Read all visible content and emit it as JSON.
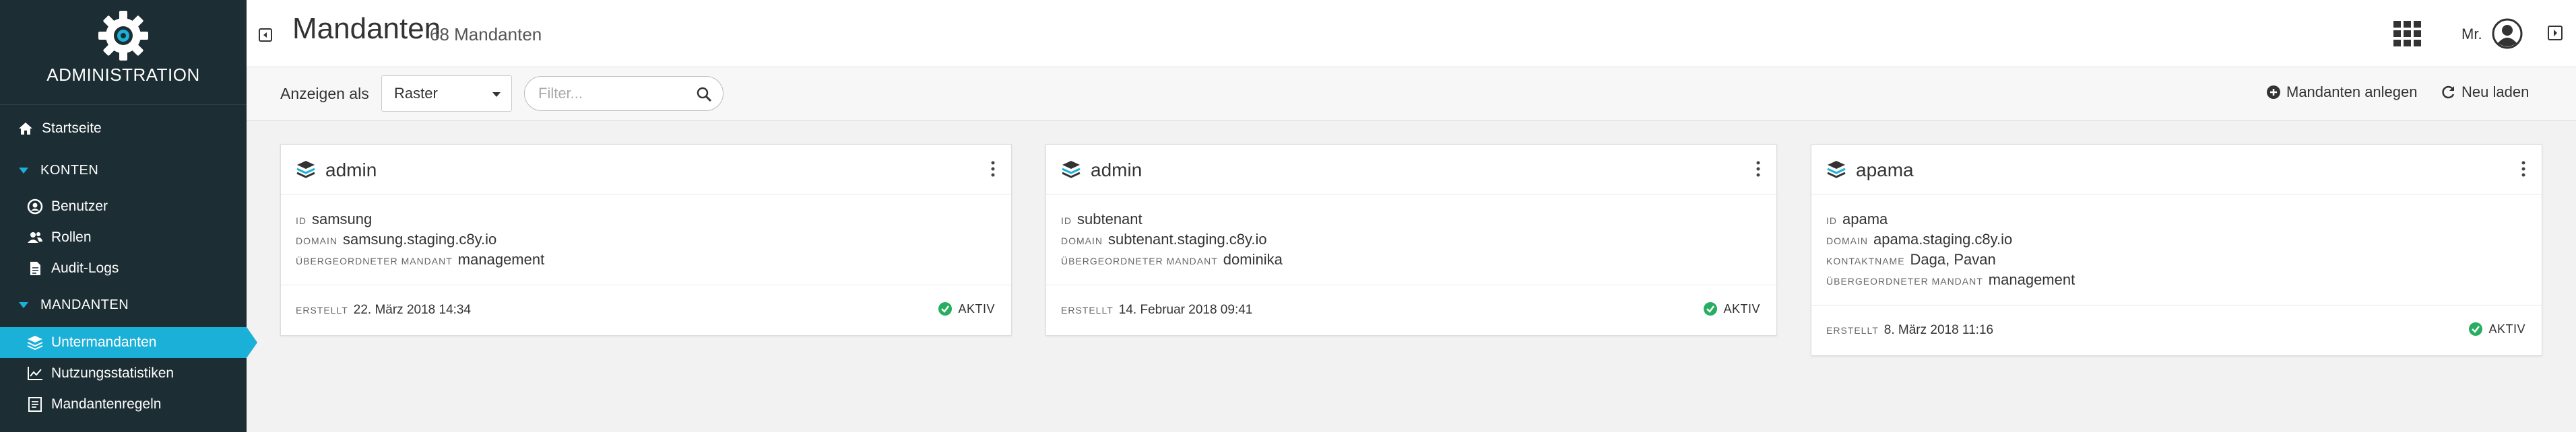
{
  "sidebar": {
    "title": "ADMINISTRATION",
    "items": {
      "home": "Startseite",
      "section_konten": "KONTEN",
      "benutzer": "Benutzer",
      "rollen": "Rollen",
      "audit_logs": "Audit-Logs",
      "section_mandanten": "MANDANTEN",
      "untermandanten": "Untermandanten",
      "nutzungsstatistiken": "Nutzungsstatistiken",
      "mandantenregeln": "Mandantenregeln"
    },
    "active_item": "Untermandanten"
  },
  "header": {
    "title": "Mandanten",
    "count": "68 Mandanten",
    "user_label": "Mr."
  },
  "toolbar": {
    "view_label": "Anzeigen als",
    "view_value": "Raster",
    "filter_placeholder": "Filter...",
    "create_label": "Mandanten anlegen",
    "reload_label": "Neu laden"
  },
  "cards": [
    {
      "name": "admin",
      "id_label": "ID",
      "id": "samsung",
      "domain_label": "DOMAIN",
      "domain": "samsung.staging.c8y.io",
      "parent_label": "ÜBERGEORDNETER MANDANT",
      "parent": "management",
      "created_label": "ERSTELLT",
      "created": "22. März 2018 14:34",
      "status": "AKTIV"
    },
    {
      "name": "admin",
      "id_label": "ID",
      "id": "subtenant",
      "domain_label": "DOMAIN",
      "domain": "subtenant.staging.c8y.io",
      "parent_label": "ÜBERGEORDNETER MANDANT",
      "parent": "dominika",
      "created_label": "ERSTELLT",
      "created": "14. Februar 2018 09:41",
      "status": "AKTIV"
    },
    {
      "name": "apama",
      "id_label": "ID",
      "id": "apama",
      "domain_label": "DOMAIN",
      "domain": "apama.staging.c8y.io",
      "contact_label": "KONTAKTNAME",
      "contact": "Daga, Pavan",
      "parent_label": "ÜBERGEORDNETER MANDANT",
      "parent": "management",
      "created_label": "ERSTELLT",
      "created": "8. März 2018 11:16",
      "status": "AKTIV"
    }
  ],
  "colors": {
    "sidebar_bg": "#1c2d33",
    "accent": "#1bb0d8",
    "status_ok": "#27ae60"
  }
}
